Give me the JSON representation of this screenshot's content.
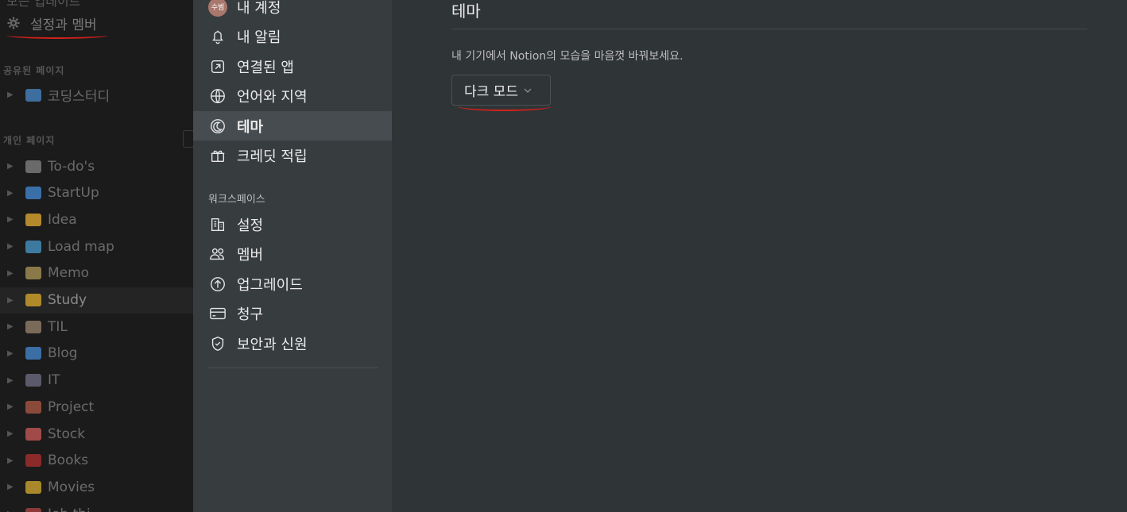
{
  "bg_sidebar": {
    "top_partial": "모든 업데이트",
    "settings_label": "설정과 멤버",
    "shared_section": "공유된 페이지",
    "shared_items": [
      {
        "label": "코딩스터디",
        "icon": "laptop-icon",
        "color": "#3d6e9e"
      }
    ],
    "private_section": "개인 페이지",
    "private_items": [
      {
        "label": "To-do's",
        "icon": "clock-icon",
        "color": "#6a6a6a"
      },
      {
        "label": "StartUp",
        "icon": "chart-icon",
        "color": "#3a6fa8"
      },
      {
        "label": "Idea",
        "icon": "bulb-icon",
        "color": "#b48a2c"
      },
      {
        "label": "Load map",
        "icon": "map-icon",
        "color": "#3e7aa0"
      },
      {
        "label": "Memo",
        "icon": "memo-icon",
        "color": "#8a7a4a"
      },
      {
        "label": "Study",
        "icon": "nerd-face-icon",
        "color": "#b08a2a"
      },
      {
        "label": "TIL",
        "icon": "person-icon",
        "color": "#7a6a5a"
      },
      {
        "label": "Blog",
        "icon": "whale-icon",
        "color": "#3a6ea5"
      },
      {
        "label": "IT",
        "icon": "floppy-icon",
        "color": "#5a5a6a"
      },
      {
        "label": "Project",
        "icon": "snowman-icon",
        "color": "#8a4a3a"
      },
      {
        "label": "Stock",
        "icon": "chart-up-icon",
        "color": "#a04a4a"
      },
      {
        "label": "Books",
        "icon": "book-icon",
        "color": "#8a2a2a"
      },
      {
        "label": "Movies",
        "icon": "popcorn-icon",
        "color": "#a8882a"
      },
      {
        "label": "Job thi",
        "icon": "item-icon",
        "color": "#8a3a3a"
      }
    ]
  },
  "modal": {
    "account_items": [
      {
        "label": "내 계정",
        "icon": "avatar-icon",
        "avatar_text": "수범"
      },
      {
        "label": "내 알림",
        "icon": "bell-icon"
      },
      {
        "label": "연결된 앱",
        "icon": "external-link-icon"
      },
      {
        "label": "언어와 지역",
        "icon": "globe-icon"
      },
      {
        "label": "테마",
        "icon": "moon-icon",
        "active": true
      },
      {
        "label": "크레딧 적립",
        "icon": "gift-icon"
      }
    ],
    "workspace_label": "워크스페이스",
    "workspace_items": [
      {
        "label": "설정",
        "icon": "building-icon"
      },
      {
        "label": "멤버",
        "icon": "people-icon"
      },
      {
        "label": "업그레이드",
        "icon": "arrow-up-circle-icon"
      },
      {
        "label": "청구",
        "icon": "credit-card-icon"
      },
      {
        "label": "보안과 신원",
        "icon": "shield-check-icon"
      }
    ],
    "main": {
      "title": "테마",
      "description": "내 기기에서 Notion의 모습을 마음껏 바꿔보세요.",
      "theme_select_value": "다크 모드"
    }
  },
  "colors": {
    "accent_underline": "#d0211a",
    "modal_sidebar": "#373c3f",
    "modal_main": "#2f3437",
    "active_nav": "#474c50"
  }
}
